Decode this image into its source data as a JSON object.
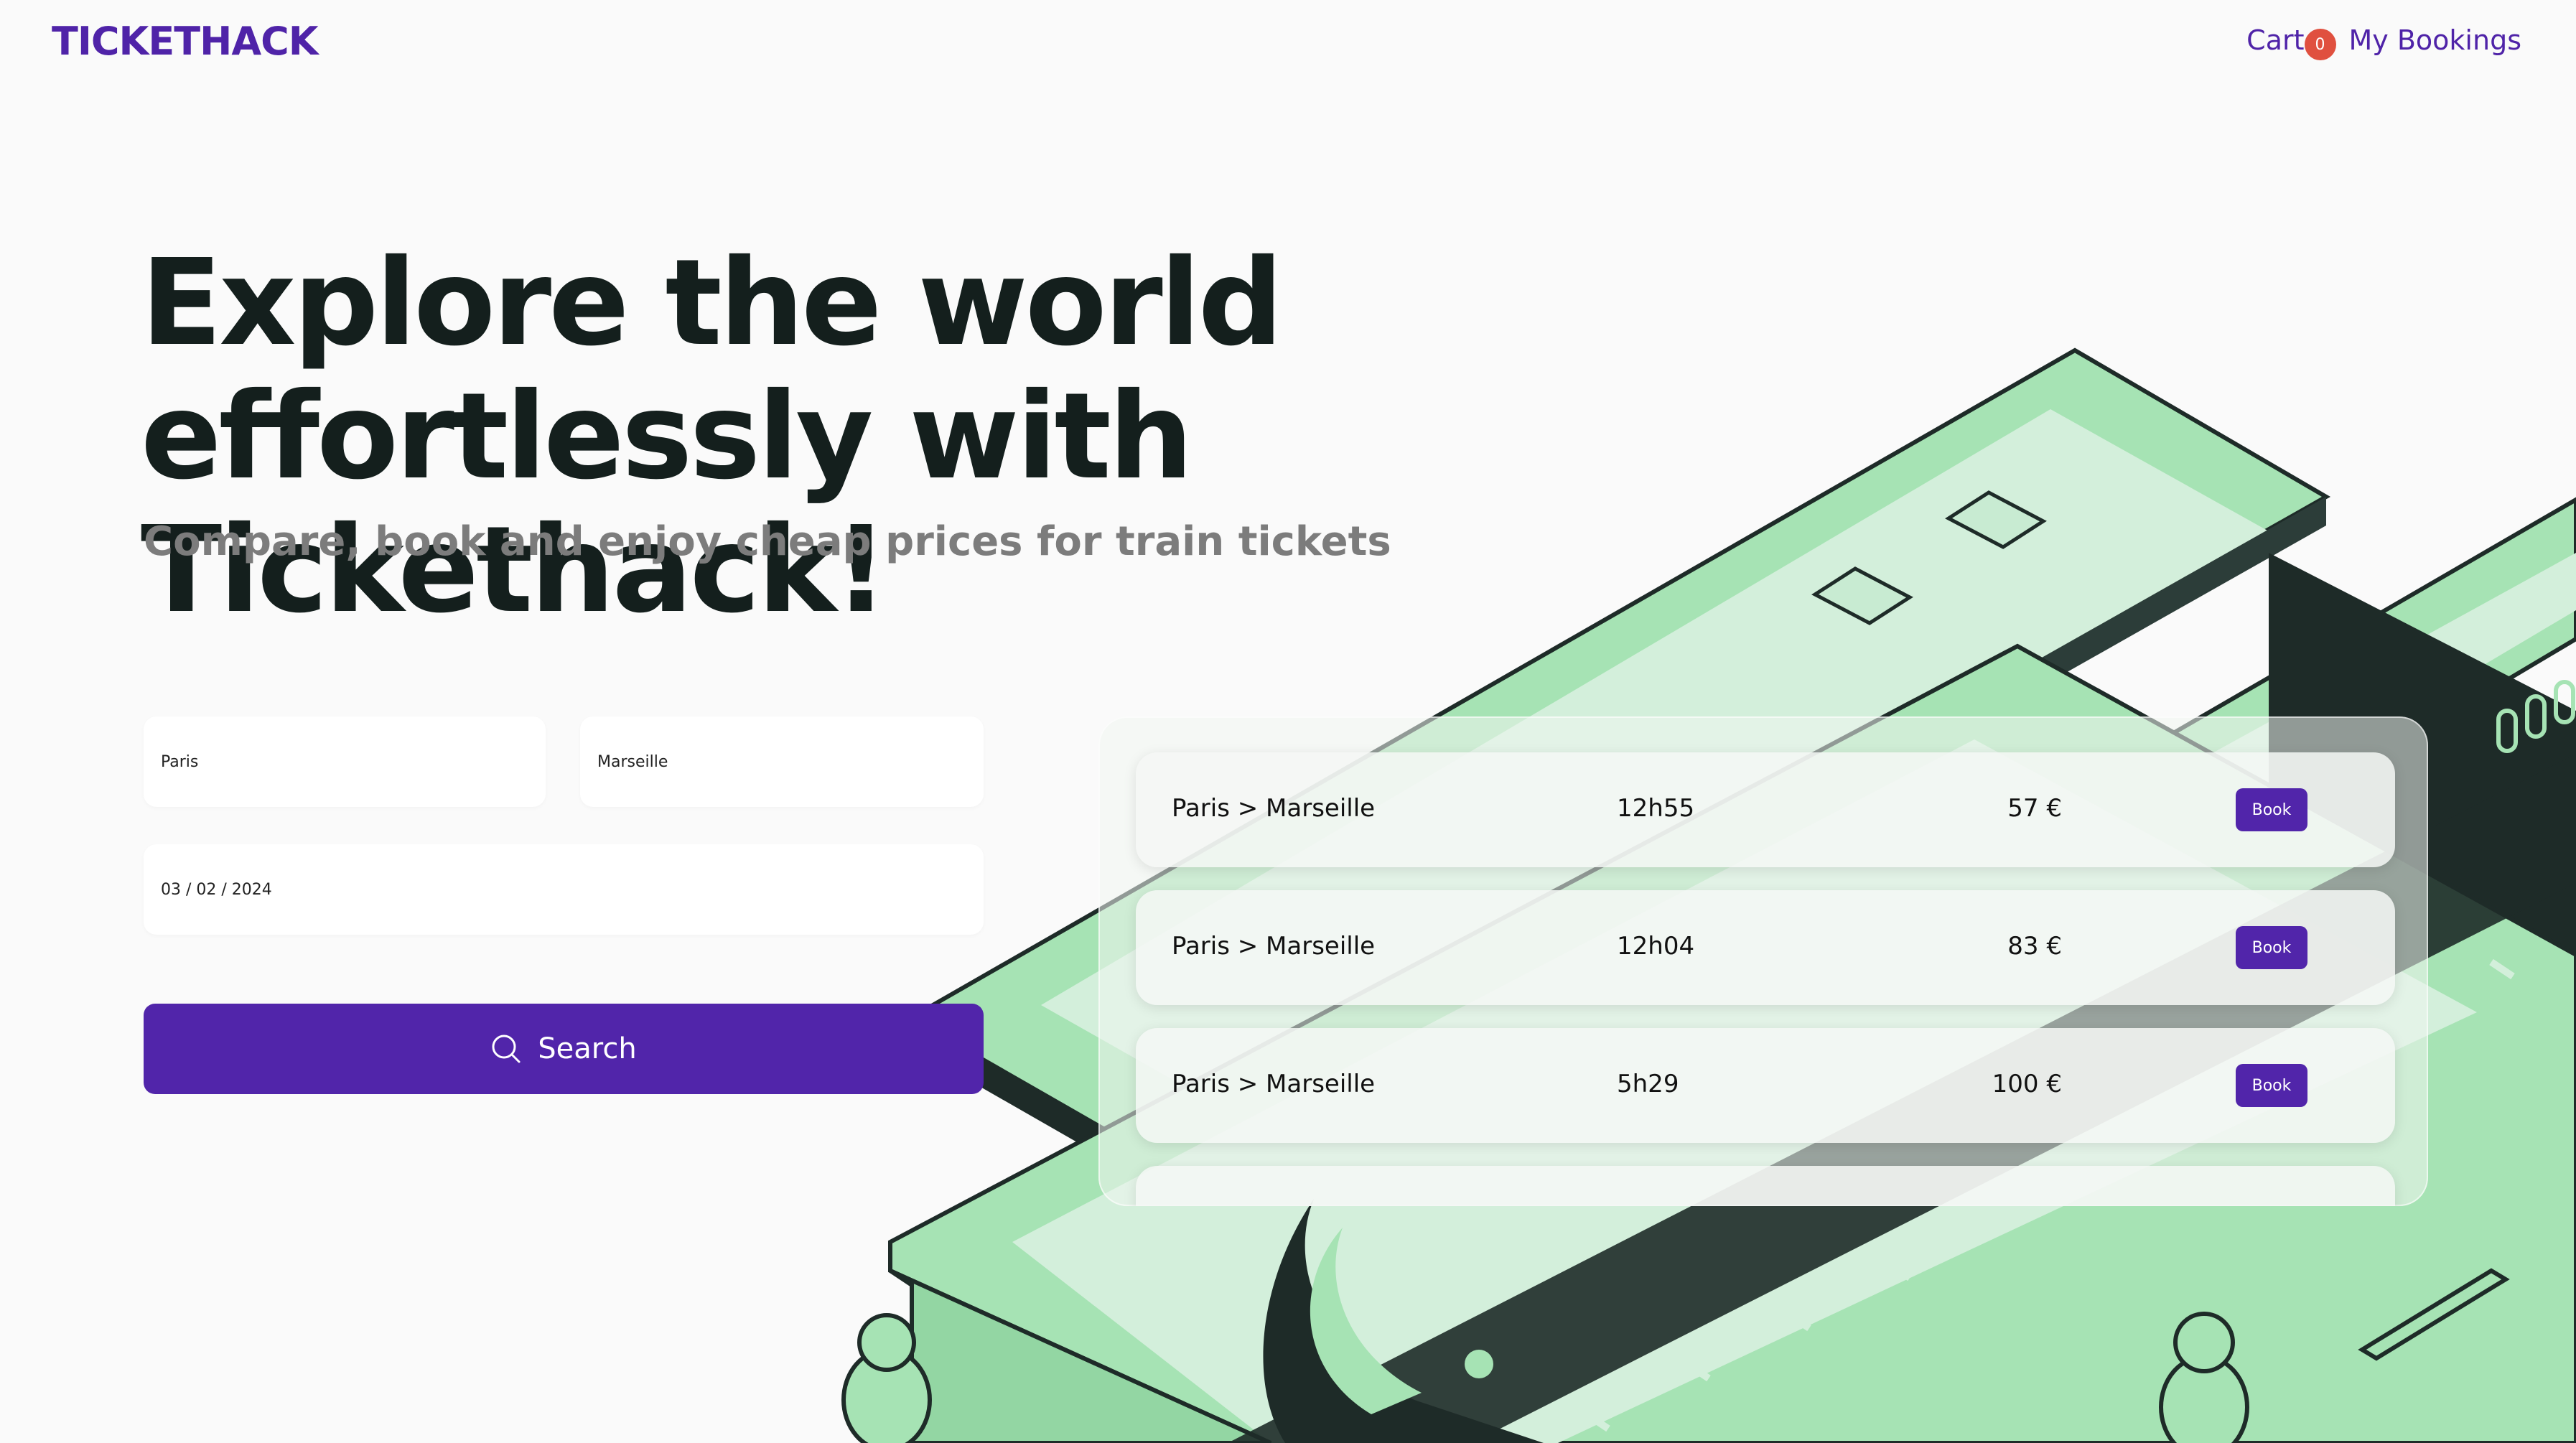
{
  "header": {
    "brand": "TICKETHACK",
    "cart_label": "Cart",
    "cart_count": "0",
    "bookings_label": "My Bookings"
  },
  "hero": {
    "title_line1": "Explore the world",
    "title_line2": "effortlessly with Tickethack!",
    "subtitle": "Compare, book and enjoy cheap prices for train tickets"
  },
  "form": {
    "departure_value": "Paris",
    "arrival_value": "Marseille",
    "date_value": "03 / 02 / 2024",
    "search_label": "Search"
  },
  "results": [
    {
      "route": "Paris > Marseille",
      "time": "12h55",
      "price": "57 €",
      "book_label": "Book"
    },
    {
      "route": "Paris > Marseille",
      "time": "12h04",
      "price": "83 €",
      "book_label": "Book"
    },
    {
      "route": "Paris > Marseille",
      "time": "5h29",
      "price": "100 €",
      "book_label": "Book"
    }
  ],
  "colors": {
    "brand": "#4f23a8",
    "button": "#5125aa",
    "badge": "#e0503f",
    "illustration_green": "#a6e3b4",
    "illustration_dark": "#1e2b28"
  }
}
